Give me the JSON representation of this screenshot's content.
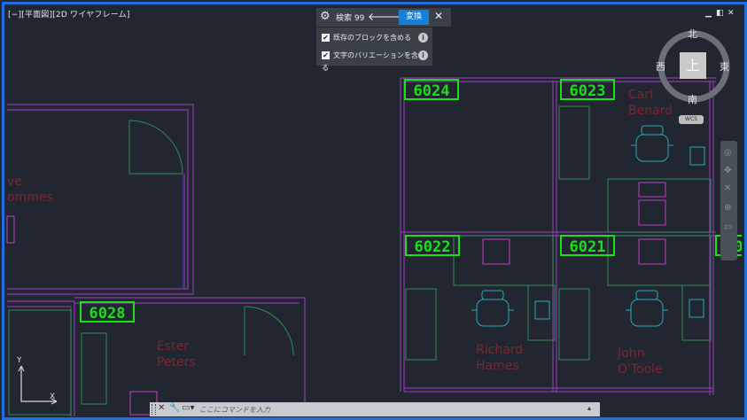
{
  "viewport": {
    "title": "[−][平面図][2D ワイヤフレーム]",
    "window_controls": [
      "▁",
      "◧",
      "✕"
    ]
  },
  "find_replace": {
    "label": "検索 99",
    "prev_icon": "arrow-left-icon",
    "next_icon": "arrow-right-icon",
    "replace_label": "変換",
    "close_icon": "close-icon",
    "options": [
      {
        "label": "既存のブロックを含める",
        "checked": true
      },
      {
        "label": "文字のバリエーションを含める",
        "checked": true
      }
    ]
  },
  "viewcube": {
    "north": "北",
    "south": "南",
    "east": "東",
    "west": "西",
    "face": "上",
    "wcs": "WCS"
  },
  "drawing": {
    "rooms": [
      "6024",
      "6023",
      "6022",
      "6021",
      "60",
      "6028"
    ],
    "names": [
      [
        "Carl",
        "Benard"
      ],
      [
        "ve",
        "ommes"
      ],
      [
        "Ester",
        "Peters"
      ],
      [
        "Richard",
        "Hames"
      ],
      [
        "John",
        "O'Toole"
      ]
    ]
  },
  "command_line": {
    "placeholder": "ここにコマンドを入力"
  },
  "ucs": {
    "x": "X",
    "y": "Y"
  },
  "colors": {
    "background": "#212630",
    "border": "#1e6fe0",
    "wall": "#8a3aa8",
    "furniture": "#2f8f56",
    "chair": "#2aa8b8",
    "tag": "#19e019",
    "name": "#7a2630",
    "accent": "#1680d8"
  }
}
